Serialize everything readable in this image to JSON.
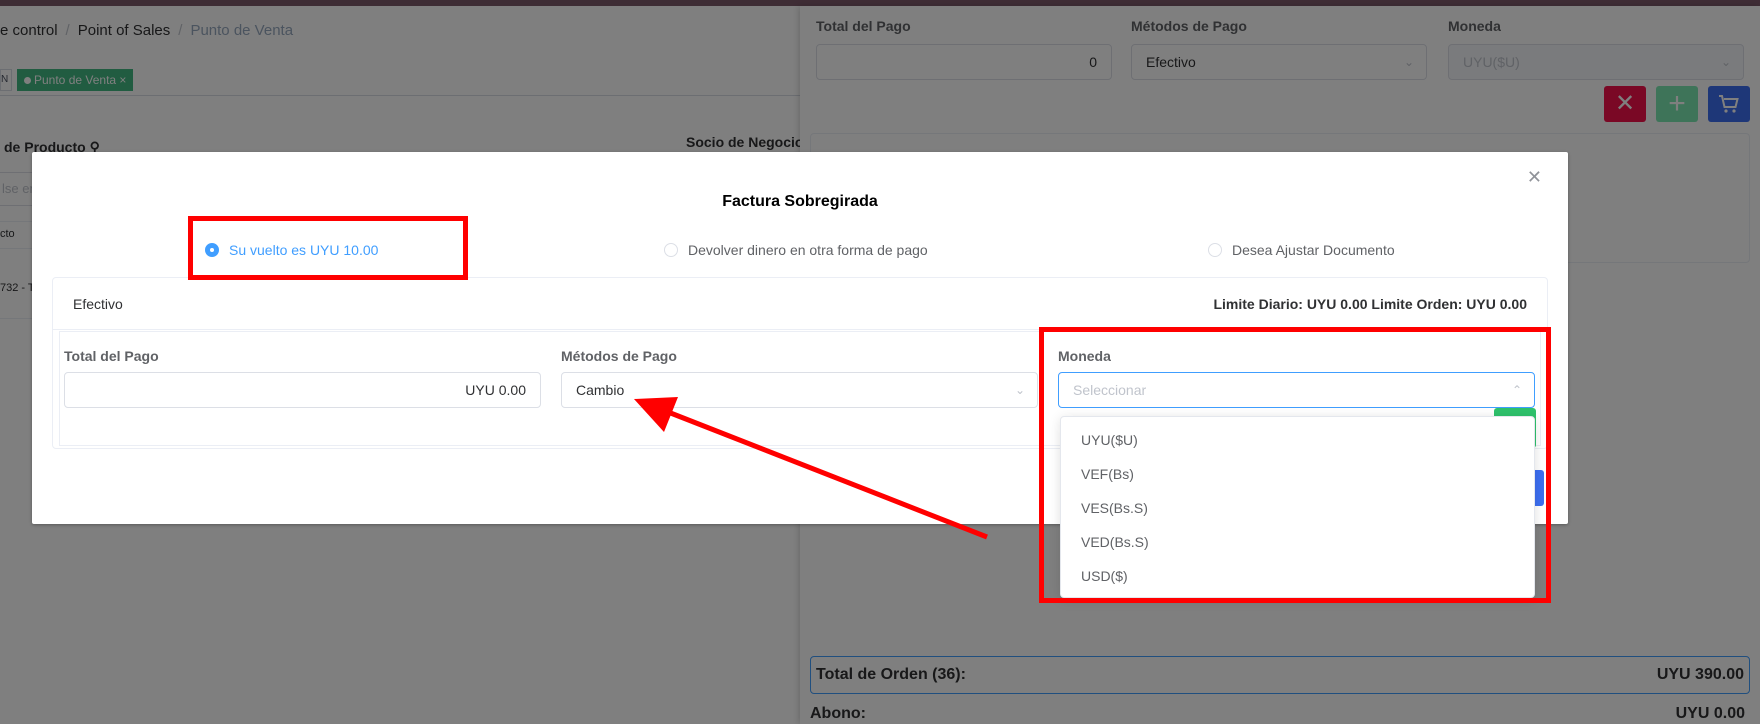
{
  "background": {
    "breadcrumb": [
      "e control",
      "Point of Sales",
      "Punto de Venta"
    ],
    "tags": {
      "small": "N",
      "active": "Punto de Venta"
    },
    "labels": {
      "producto": "de Producto",
      "socio": "Socio de Negocio",
      "col": "cto",
      "row": "732 - T"
    },
    "search_placeholder": "lse en"
  },
  "drawer": {
    "labels": [
      "Total del Pago",
      "Métodos de Pago",
      "Moneda"
    ],
    "total_value": "0",
    "method_value": "Efectivo",
    "currency_value": "UYU($U)",
    "order_total_label": "Total de Orden (36):",
    "order_total_value": "UYU 390.00",
    "abono_label": "Abono:",
    "abono_value": "UYU 0.00"
  },
  "modal": {
    "title": "Factura Sobregirada",
    "radios": [
      {
        "label": "Su vuelto es UYU 10.00",
        "checked": true
      },
      {
        "label": "Devolver dinero en otra forma de pago",
        "checked": false
      },
      {
        "label": "Desea Ajustar Documento",
        "checked": false
      }
    ],
    "card_title": "Efectivo",
    "limits": "Limite Diario: UYU 0.00 Limite Orden: UYU 0.00",
    "fields": {
      "total_label": "Total del Pago",
      "total_value": "UYU 0.00",
      "method_label": "Métodos de Pago",
      "method_value": "Cambio",
      "currency_label": "Moneda",
      "currency_placeholder": "Seleccionar"
    },
    "currency_options": [
      "UYU($U)",
      "VEF(Bs)",
      "VES(Bs.S)",
      "VED(Bs.S)",
      "USD($)"
    ]
  },
  "colors": {
    "accent": "#409eff",
    "annotation": "#ff0000",
    "danger": "#f5114a",
    "success": "#7de8b3",
    "primary": "#3d6ff0"
  }
}
